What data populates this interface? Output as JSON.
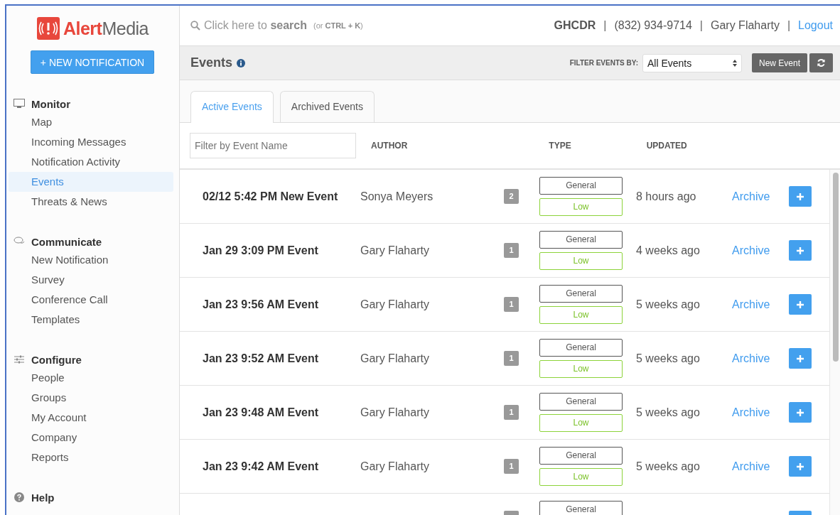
{
  "logo": {
    "brand": "Alert",
    "product": "Media"
  },
  "new_notification_button": "+ NEW NOTIFICATION",
  "sidebar": {
    "sections": [
      {
        "kind": "monitor",
        "title": "Monitor",
        "items": [
          {
            "label": "Map",
            "selected": false
          },
          {
            "label": "Incoming Messages",
            "selected": false
          },
          {
            "label": "Notification Activity",
            "selected": false
          },
          {
            "label": "Events",
            "selected": true
          },
          {
            "label": "Threats & News",
            "selected": false
          }
        ]
      },
      {
        "kind": "communicate",
        "title": "Communicate",
        "items": [
          {
            "label": "New Notification",
            "selected": false
          },
          {
            "label": "Survey",
            "selected": false
          },
          {
            "label": "Conference Call",
            "selected": false
          },
          {
            "label": "Templates",
            "selected": false
          }
        ]
      },
      {
        "kind": "configure",
        "title": "Configure",
        "items": [
          {
            "label": "People",
            "selected": false
          },
          {
            "label": "Groups",
            "selected": false
          },
          {
            "label": "My Account",
            "selected": false
          },
          {
            "label": "Company",
            "selected": false
          },
          {
            "label": "Reports",
            "selected": false
          }
        ]
      },
      {
        "kind": "help",
        "title": "Help"
      }
    ]
  },
  "search": {
    "placeholder": "Click here to **search**",
    "hint": "(or **CTRL + K**)"
  },
  "header": {
    "account": "GHCDR",
    "phone": "(832) 934-9714",
    "user": "Gary Flaharty",
    "logout": "Logout",
    "separators": [
      "|",
      "|",
      "|"
    ]
  },
  "page": {
    "title": "Events",
    "filter_label": "FILTER EVENTS BY:",
    "filter_value": "All Events",
    "new_event": "New Event"
  },
  "tabs": [
    {
      "label": "Active Events",
      "selected": true
    },
    {
      "label": "Archived Events",
      "selected": false
    }
  ],
  "table": {
    "filter_placeholder": "Filter by Event Name",
    "columns": [
      "AUTHOR",
      "TYPE",
      "UPDATED"
    ],
    "rows": [
      {
        "name": "02/12 5:42 PM New Event",
        "author": "Sonya Meyers",
        "count": "2",
        "type": "General",
        "priority": "Low",
        "updated": "8 hours ago",
        "action": "Archive"
      },
      {
        "name": "Jan 29 3:09 PM Event",
        "author": "Gary Flaharty",
        "count": "1",
        "type": "General",
        "priority": "Low",
        "updated": "4 weeks ago",
        "action": "Archive"
      },
      {
        "name": "Jan 23 9:56 AM Event",
        "author": "Gary Flaharty",
        "count": "1",
        "type": "General",
        "priority": "Low",
        "updated": "5 weeks ago",
        "action": "Archive"
      },
      {
        "name": "Jan 23 9:52 AM Event",
        "author": "Gary Flaharty",
        "count": "1",
        "type": "General",
        "priority": "Low",
        "updated": "5 weeks ago",
        "action": "Archive"
      },
      {
        "name": "Jan 23 9:48 AM Event",
        "author": "Gary Flaharty",
        "count": "1",
        "type": "General",
        "priority": "Low",
        "updated": "5 weeks ago",
        "action": "Archive"
      },
      {
        "name": "Jan 23 9:42 AM Event",
        "author": "Gary Flaharty",
        "count": "1",
        "type": "General",
        "priority": "Low",
        "updated": "5 weeks ago",
        "action": "Archive"
      },
      {
        "type": "General"
      }
    ]
  }
}
